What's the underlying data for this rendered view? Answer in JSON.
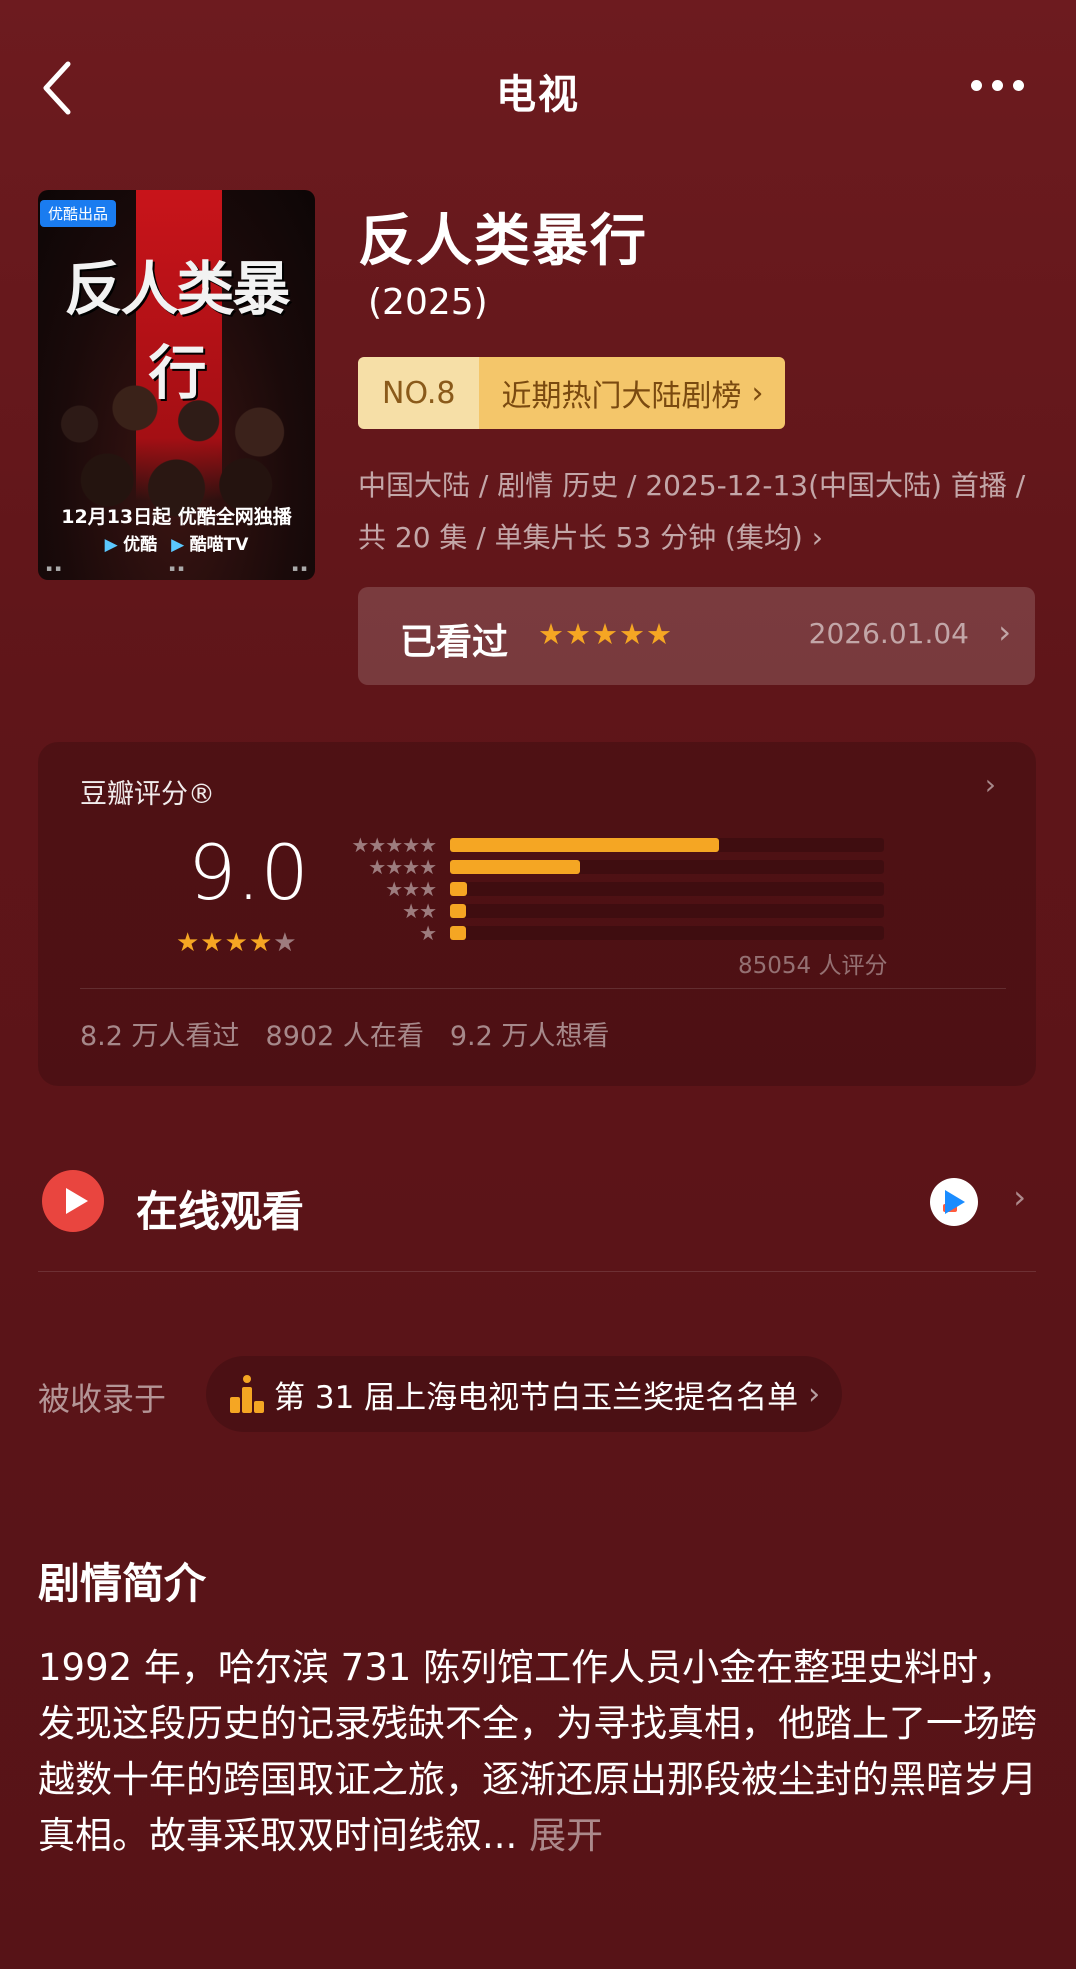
{
  "header": {
    "title": "电视"
  },
  "poster": {
    "tag": "优酷出品",
    "title": "反人类暴行",
    "date_line": "12月13日起 优酷全网独播",
    "platform_1": "优酷",
    "platform_2": "酷喵TV"
  },
  "show": {
    "name": "反人类暴行",
    "year": "(2025)",
    "rank_no": "NO.8",
    "rank_label": "近期热门大陆剧榜",
    "meta": "中国大陆 / 剧情 历史 / 2025-12-13(中国大陆) 首播 / 共 20 集 / 单集片长 53 分钟 (集均)"
  },
  "watched": {
    "label": "已看过",
    "stars": "★★★★★",
    "date": "2026.01.04",
    "user_stars_value": 5
  },
  "rating": {
    "title": "豆瓣评分®",
    "score": "9.0",
    "stars_full": "★★★★",
    "stars_half": "★",
    "count": "85054 人评分",
    "distribution": [
      0.62,
      0.3,
      0.04,
      0.03,
      0.03
    ],
    "star_rows": [
      "★★★★★",
      "★★★★",
      "★★★",
      "★★",
      "★"
    ],
    "stats": [
      "8.2 万人看过",
      "8902 人在看",
      "9.2 万人想看"
    ]
  },
  "watch_online": {
    "label": "在线观看"
  },
  "collected": {
    "label": "被收录于",
    "item": "第 31 届上海电视节白玉兰奖提名名单"
  },
  "synopsis": {
    "title": "剧情简介",
    "text": "1992 年，哈尔滨 731 陈列馆工作人员小金在整理史料时，发现这段历史的记录残缺不全，为寻找真相，他踏上了一场跨越数十年的跨国取证之旅，逐渐还原出那段被尘封的黑暗岁月真相。故事采取双时间线叙...",
    "expand": "展开"
  },
  "colors": {
    "accent": "#f5a623",
    "background": "#5f1519",
    "play": "#e9453f"
  }
}
